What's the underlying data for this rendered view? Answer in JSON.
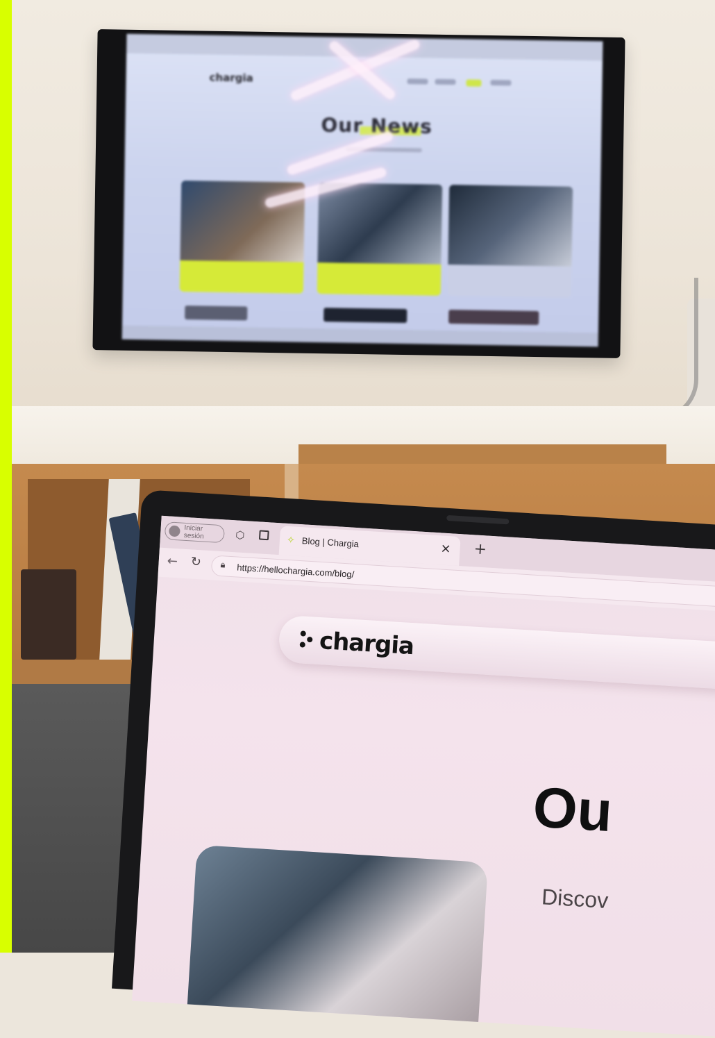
{
  "accent_color": "#d8ff00",
  "tv_screen": {
    "logo_text": "chargia",
    "heading": "Our News"
  },
  "laptop_browser": {
    "signin_label": "Iniciar sesión",
    "tab_title": "Blog | Chargia",
    "tab_close_label": "×",
    "new_tab_label": "+",
    "url": "https://hellochargia.com/blog/",
    "icons": [
      "person-icon",
      "workspaces-icon",
      "tabs-icon",
      "chargia-favicon",
      "back-arrow-icon",
      "refresh-icon",
      "lock-icon"
    ]
  },
  "laptop_page": {
    "logo_text": "chargia",
    "heading_partial": "Ou",
    "subheading_partial": "Discov"
  }
}
